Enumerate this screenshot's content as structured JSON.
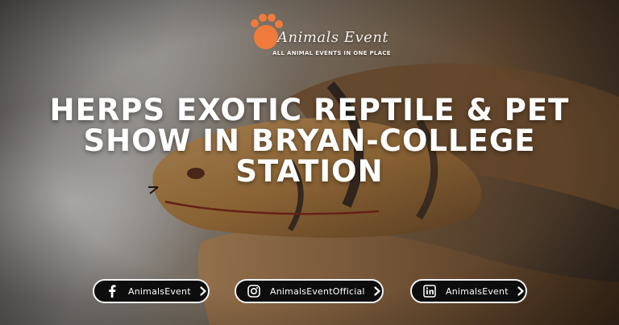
{
  "logo": {
    "name": "Animals Event",
    "tagline": "ALL ANIMAL EVENTS IN ONE PLACE"
  },
  "headline": {
    "line1": "HERPS EXOTIC REPTILE & PET",
    "line2": "SHOW IN BRYAN-COLLEGE",
    "line3": "STATION"
  },
  "socials": [
    {
      "platform": "facebook",
      "icon": "facebook-icon",
      "label": "AnimalsEvent"
    },
    {
      "platform": "instagram",
      "icon": "instagram-icon",
      "label": "AnimalsEventOfficial"
    },
    {
      "platform": "linkedin",
      "icon": "linkedin-icon",
      "label": "AnimalsEvent"
    }
  ],
  "colors": {
    "brand_orange": "#f07a3a",
    "headline_text": "#ffffff",
    "pill_background": "#0d0d0d"
  }
}
